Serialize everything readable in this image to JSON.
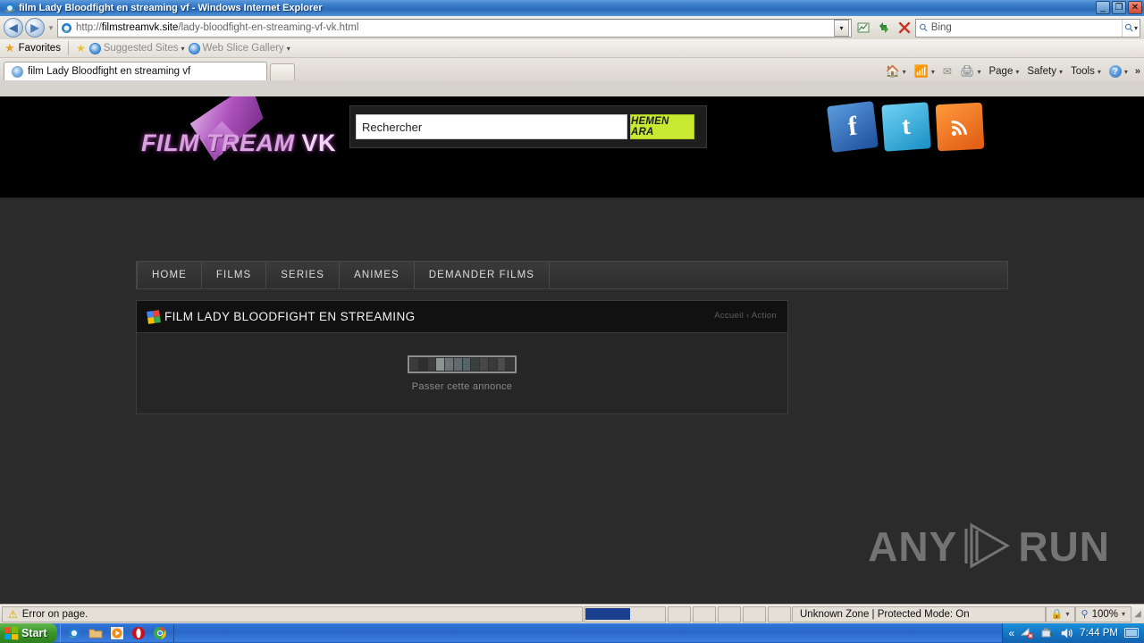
{
  "window": {
    "title": "film Lady Bloodfight en streaming vf - Windows Internet Explorer",
    "minimize_label": "_",
    "maximize_label": "❐",
    "close_label": "✕"
  },
  "address_bar": {
    "back_label": "◀",
    "forward_label": "▶",
    "history_caret": "▾",
    "url_prefix": "http://",
    "url_domain": "filmstreamvk.site",
    "url_path": "/lady-bloodfight-en-streaming-vf-vk.html",
    "url_full": "http://filmstreamvk.site/lady-bloodfight-en-streaming-vf-vk.html",
    "dropdown_label": "▾",
    "compat_icon": "compatibility-view-icon",
    "refresh_label": "↻",
    "stop_label": "✕",
    "search_placeholder": "Bing",
    "search_go_label": "⌕",
    "search_caret": "▾"
  },
  "favorites_bar": {
    "favorites_label": "Favorites",
    "add_to_favorites_icon": "add-favorites-icon",
    "items": [
      {
        "label": "Suggested Sites",
        "caret": "▾"
      },
      {
        "label": "Web Slice Gallery",
        "caret": "▾"
      }
    ]
  },
  "tabs": {
    "items": [
      {
        "label": "film Lady Bloodfight en streaming vf"
      }
    ],
    "new_tab_label": ""
  },
  "command_bar": {
    "home_caret": "▾",
    "feeds_caret": "▾",
    "print_caret": "▾",
    "page_label": "Page",
    "page_caret": "▾",
    "safety_label": "Safety",
    "safety_caret": "▾",
    "tools_label": "Tools",
    "tools_caret": "▾",
    "help_label": "?",
    "help_caret": "▾",
    "overflow_label": "»"
  },
  "site": {
    "logo": {
      "text_main": "FILM  TREAM",
      "text_vk": "VK"
    },
    "search": {
      "placeholder": "Rechercher",
      "value": "Rechercher",
      "button_label": "HEMEN ARA"
    },
    "social": [
      {
        "name": "facebook",
        "glyph": "f"
      },
      {
        "name": "twitter",
        "glyph": "t"
      },
      {
        "name": "rss",
        "glyph": "◔"
      }
    ],
    "nav": [
      {
        "label": "HOME"
      },
      {
        "label": "FILMS"
      },
      {
        "label": "SERIES"
      },
      {
        "label": "ANIMES"
      },
      {
        "label": "DEMANDER FILMS"
      }
    ],
    "panel": {
      "title": "FILM LADY BLOODFIGHT EN STREAMING",
      "breadcrumb": "Accueil › Action",
      "skip_ad_label": "Passer cette annonce",
      "loader_segments": [
        "#3b3b3b",
        "#2f2f2f",
        "#3e3e3e",
        "#8d9393",
        "#6e7474",
        "#5e6a6c",
        "#55666b",
        "#3a3f41",
        "#474747",
        "#3a3a3a",
        "#4c4c4c",
        "#353535"
      ]
    },
    "watermark": {
      "left": "ANY",
      "right": "RUN"
    }
  },
  "status_bar": {
    "error_text": "Error on page.",
    "warning_icon": "warning-icon",
    "zone_text": "Unknown Zone | Protected Mode: On",
    "lock_caret": "▾",
    "zoom_level": "100%",
    "zoom_caret": "▾"
  },
  "taskbar": {
    "start_label": "Start",
    "quick_launch": [
      {
        "name": "internet-explorer",
        "glyph": "e"
      },
      {
        "name": "windows-explorer",
        "glyph": "▬"
      },
      {
        "name": "media-player",
        "glyph": "▶"
      },
      {
        "name": "opera",
        "glyph": "O"
      },
      {
        "name": "chrome",
        "glyph": "◉"
      }
    ],
    "tray": {
      "expand_label": "«",
      "network_icon": "network-error-icon",
      "devices_icon": "safely-remove-icon",
      "volume_icon": "volume-icon",
      "clock": "7:44 PM",
      "show_desktop_icon": "show-desktop-icon"
    }
  },
  "colors": {
    "accent_green": "#c8e832",
    "site_black": "#000000",
    "site_dark": "#2b2b2b",
    "logo_pink": "#d9a3e0"
  }
}
